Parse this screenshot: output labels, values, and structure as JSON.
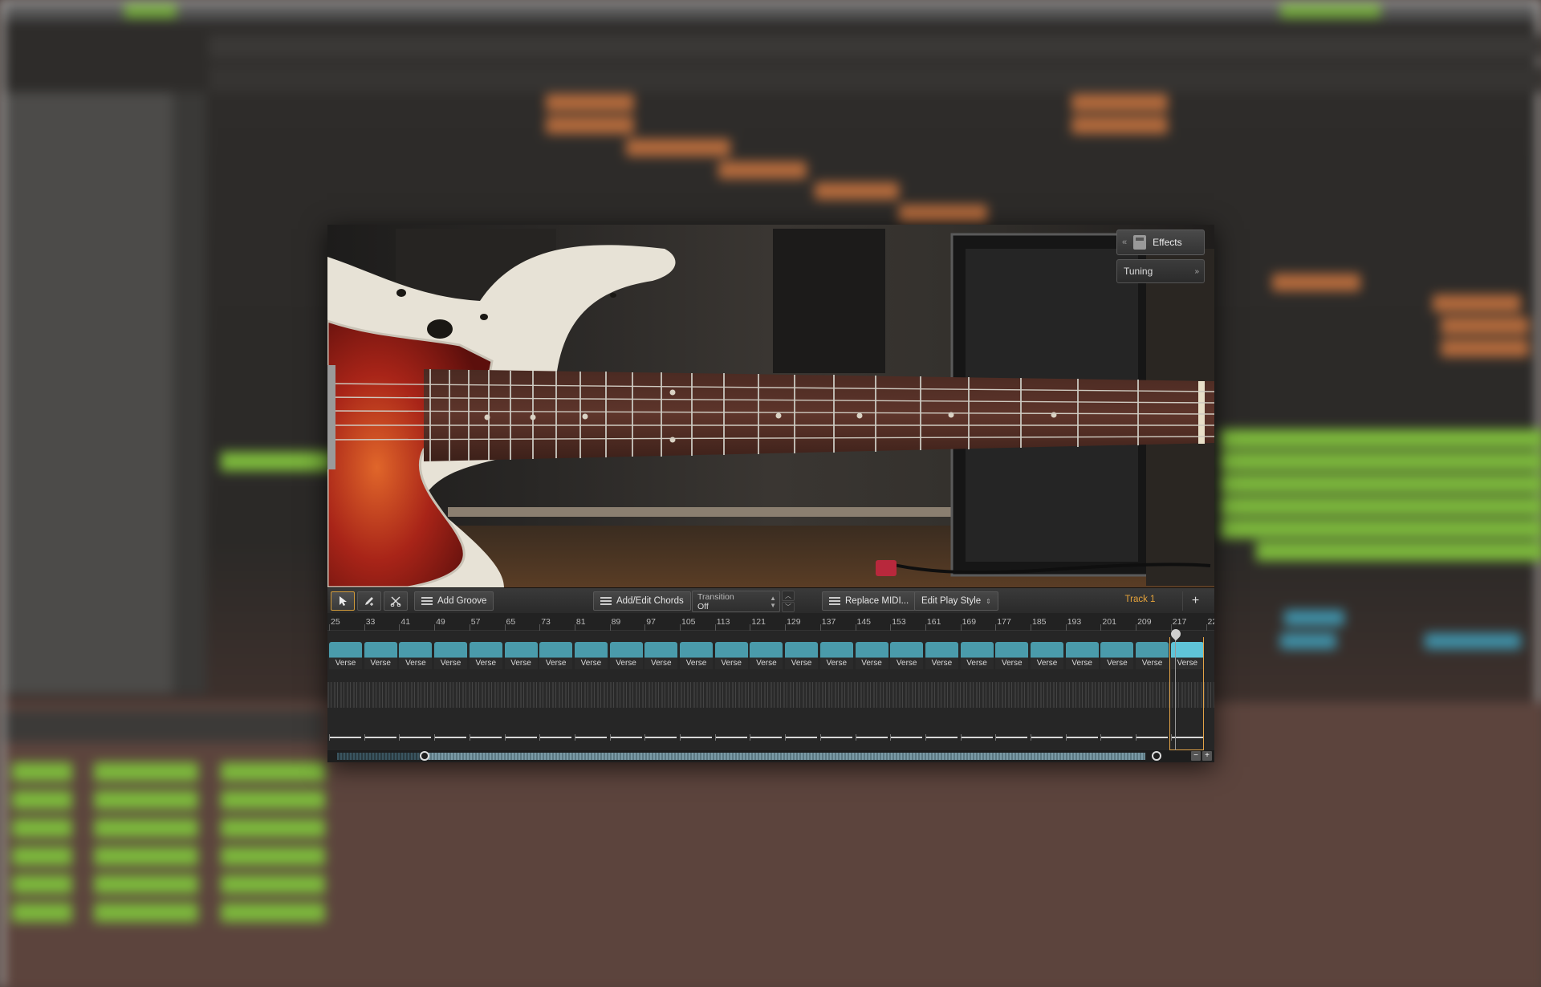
{
  "toolbar": {
    "add_groove_label": "Add Groove",
    "add_edit_chords_label": "Add/Edit Chords",
    "transition_label": "Transition",
    "transition_value": "Off",
    "replace_midi_label": "Replace MIDI...",
    "edit_play_style_label": "Edit Play Style",
    "track_name": "Track 1",
    "add_track_glyph": "+"
  },
  "effects": {
    "effects_label": "Effects",
    "tuning_label": "Tuning"
  },
  "ruler": {
    "bars": [
      "25",
      "33",
      "41",
      "49",
      "57",
      "65",
      "73",
      "81",
      "89",
      "97",
      "105",
      "113",
      "121",
      "129",
      "137",
      "145",
      "153",
      "161",
      "169",
      "177",
      "185",
      "193",
      "201",
      "209",
      "217",
      "22"
    ]
  },
  "sections": [
    "Verse",
    "Verse",
    "Verse",
    "Verse",
    "Verse",
    "Verse",
    "Verse",
    "Verse",
    "Verse",
    "Verse",
    "Verse",
    "Verse",
    "Verse",
    "Verse",
    "Verse",
    "Verse",
    "Verse",
    "Verse",
    "Verse",
    "Verse",
    "Verse",
    "Verse",
    "Verse",
    "Verse",
    "Verse"
  ],
  "selected_section_index": 24,
  "colors": {
    "section_block": "#4a9bab",
    "section_selected": "#5fc4d8",
    "accent_orange": "#e3a347",
    "track_label": "#e6a33a"
  },
  "zoom": {
    "minus": "−",
    "plus": "+"
  }
}
